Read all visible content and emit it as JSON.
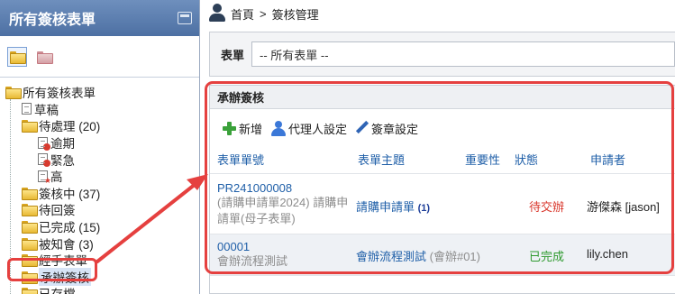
{
  "left_panel": {
    "title": "所有簽核表單",
    "tree": [
      {
        "label": "所有簽核表單",
        "level": 0,
        "icon": "folder-icon"
      },
      {
        "label": "草稿",
        "level": 1,
        "icon": "document-icon"
      },
      {
        "label": "待處理 (20)",
        "level": 1,
        "icon": "folder-icon"
      },
      {
        "label": "逾期",
        "level": 2,
        "icon": "overdue-document-icon"
      },
      {
        "label": "緊急",
        "level": 2,
        "icon": "urgent-document-icon"
      },
      {
        "label": "高",
        "level": 2,
        "icon": "high-priority-document-icon"
      },
      {
        "label": "簽核中 (37)",
        "level": 1,
        "icon": "folder-icon"
      },
      {
        "label": "待回簽",
        "level": 1,
        "icon": "folder-icon"
      },
      {
        "label": "已完成 (15)",
        "level": 1,
        "icon": "folder-icon"
      },
      {
        "label": "被知會 (3)",
        "level": 1,
        "icon": "folder-icon"
      },
      {
        "label": "經手表單",
        "level": 1,
        "icon": "folder-icon"
      },
      {
        "label": "承辦簽核",
        "level": 1,
        "icon": "folder-icon",
        "selected": true
      },
      {
        "label": "已存檔",
        "level": 1,
        "icon": "folder-icon"
      }
    ]
  },
  "breadcrumb": {
    "home": "首頁",
    "separator": ">",
    "current": "簽核管理"
  },
  "filter": {
    "label": "表單",
    "value": "-- 所有表單 --"
  },
  "panel": {
    "title": "承辦簽核",
    "toolbar": {
      "add": "新增",
      "agent": "代理人設定",
      "signature": "簽章設定"
    },
    "columns": {
      "form_no": "表單單號",
      "subject": "表單主題",
      "importance": "重要性",
      "status": "狀態",
      "applicant": "申請者"
    },
    "rows": [
      {
        "form_no": "PR241000008",
        "form_desc": "(請購申請單2024) 請購申請單(母子表單)",
        "subject": "請購申請單",
        "subject_count": "(1)",
        "importance": "",
        "status": "待交辦",
        "applicant": "游傑森 [jason]"
      },
      {
        "form_no": "00001",
        "form_desc": "會辦流程測試",
        "subject": "會辦流程測試",
        "subject_extra": "(會辦#01)",
        "importance": "",
        "status": "已完成",
        "applicant": "lily.chen"
      }
    ]
  },
  "colors": {
    "header_blue": "#4d70a3",
    "link_blue": "#1f5fa8",
    "highlight_red": "#e5403f",
    "status_pending": "#d9362b",
    "status_done": "#2f9a2f"
  }
}
